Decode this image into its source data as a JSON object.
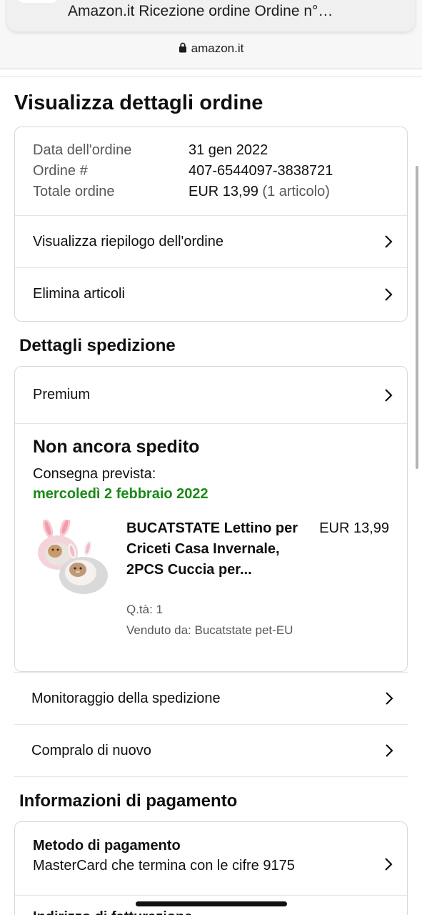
{
  "browser": {
    "notification_text": "Amazon.it Ricezione ordine Ordine n°…",
    "url": "amazon.it"
  },
  "page": {
    "title": "Visualizza dettagli ordine"
  },
  "order": {
    "date_label": "Data dell'ordine",
    "date_value": "31 gen 2022",
    "number_label": "Ordine #",
    "number_value": "407-6544097-3838721",
    "total_label": "Totale ordine",
    "total_value": "EUR 13,99",
    "total_items": "(1 articolo)",
    "summary_link": "Visualizza riepilogo dell'ordine",
    "delete_link": "Elimina articoli"
  },
  "shipping": {
    "section_title": "Dettagli spedizione",
    "method": "Premium",
    "status": "Non ancora spedito",
    "expected_label": "Consegna prevista:",
    "expected_date": "mercoledì 2 febbraio 2022",
    "product": {
      "title": "BUCATSTATE Lettino per Criceti Casa Invernale, 2PCS Cuccia per...",
      "price": "EUR 13,99",
      "qty": "Q.tà: 1",
      "seller": "Venduto da: Bucatstate pet-EU"
    },
    "track_link": "Monitoraggio della spedizione",
    "buy_again_link": "Compralo di nuovo"
  },
  "payment": {
    "section_title": "Informazioni di pagamento",
    "method_title": "Metodo di pagamento",
    "method_value": "MasterCard che termina con le cifre 9175",
    "next_title": "Indirizzo di fatturazione"
  },
  "colors": {
    "delivery_green": "#1a8a16",
    "text": "#0f1111",
    "muted": "#565959"
  }
}
